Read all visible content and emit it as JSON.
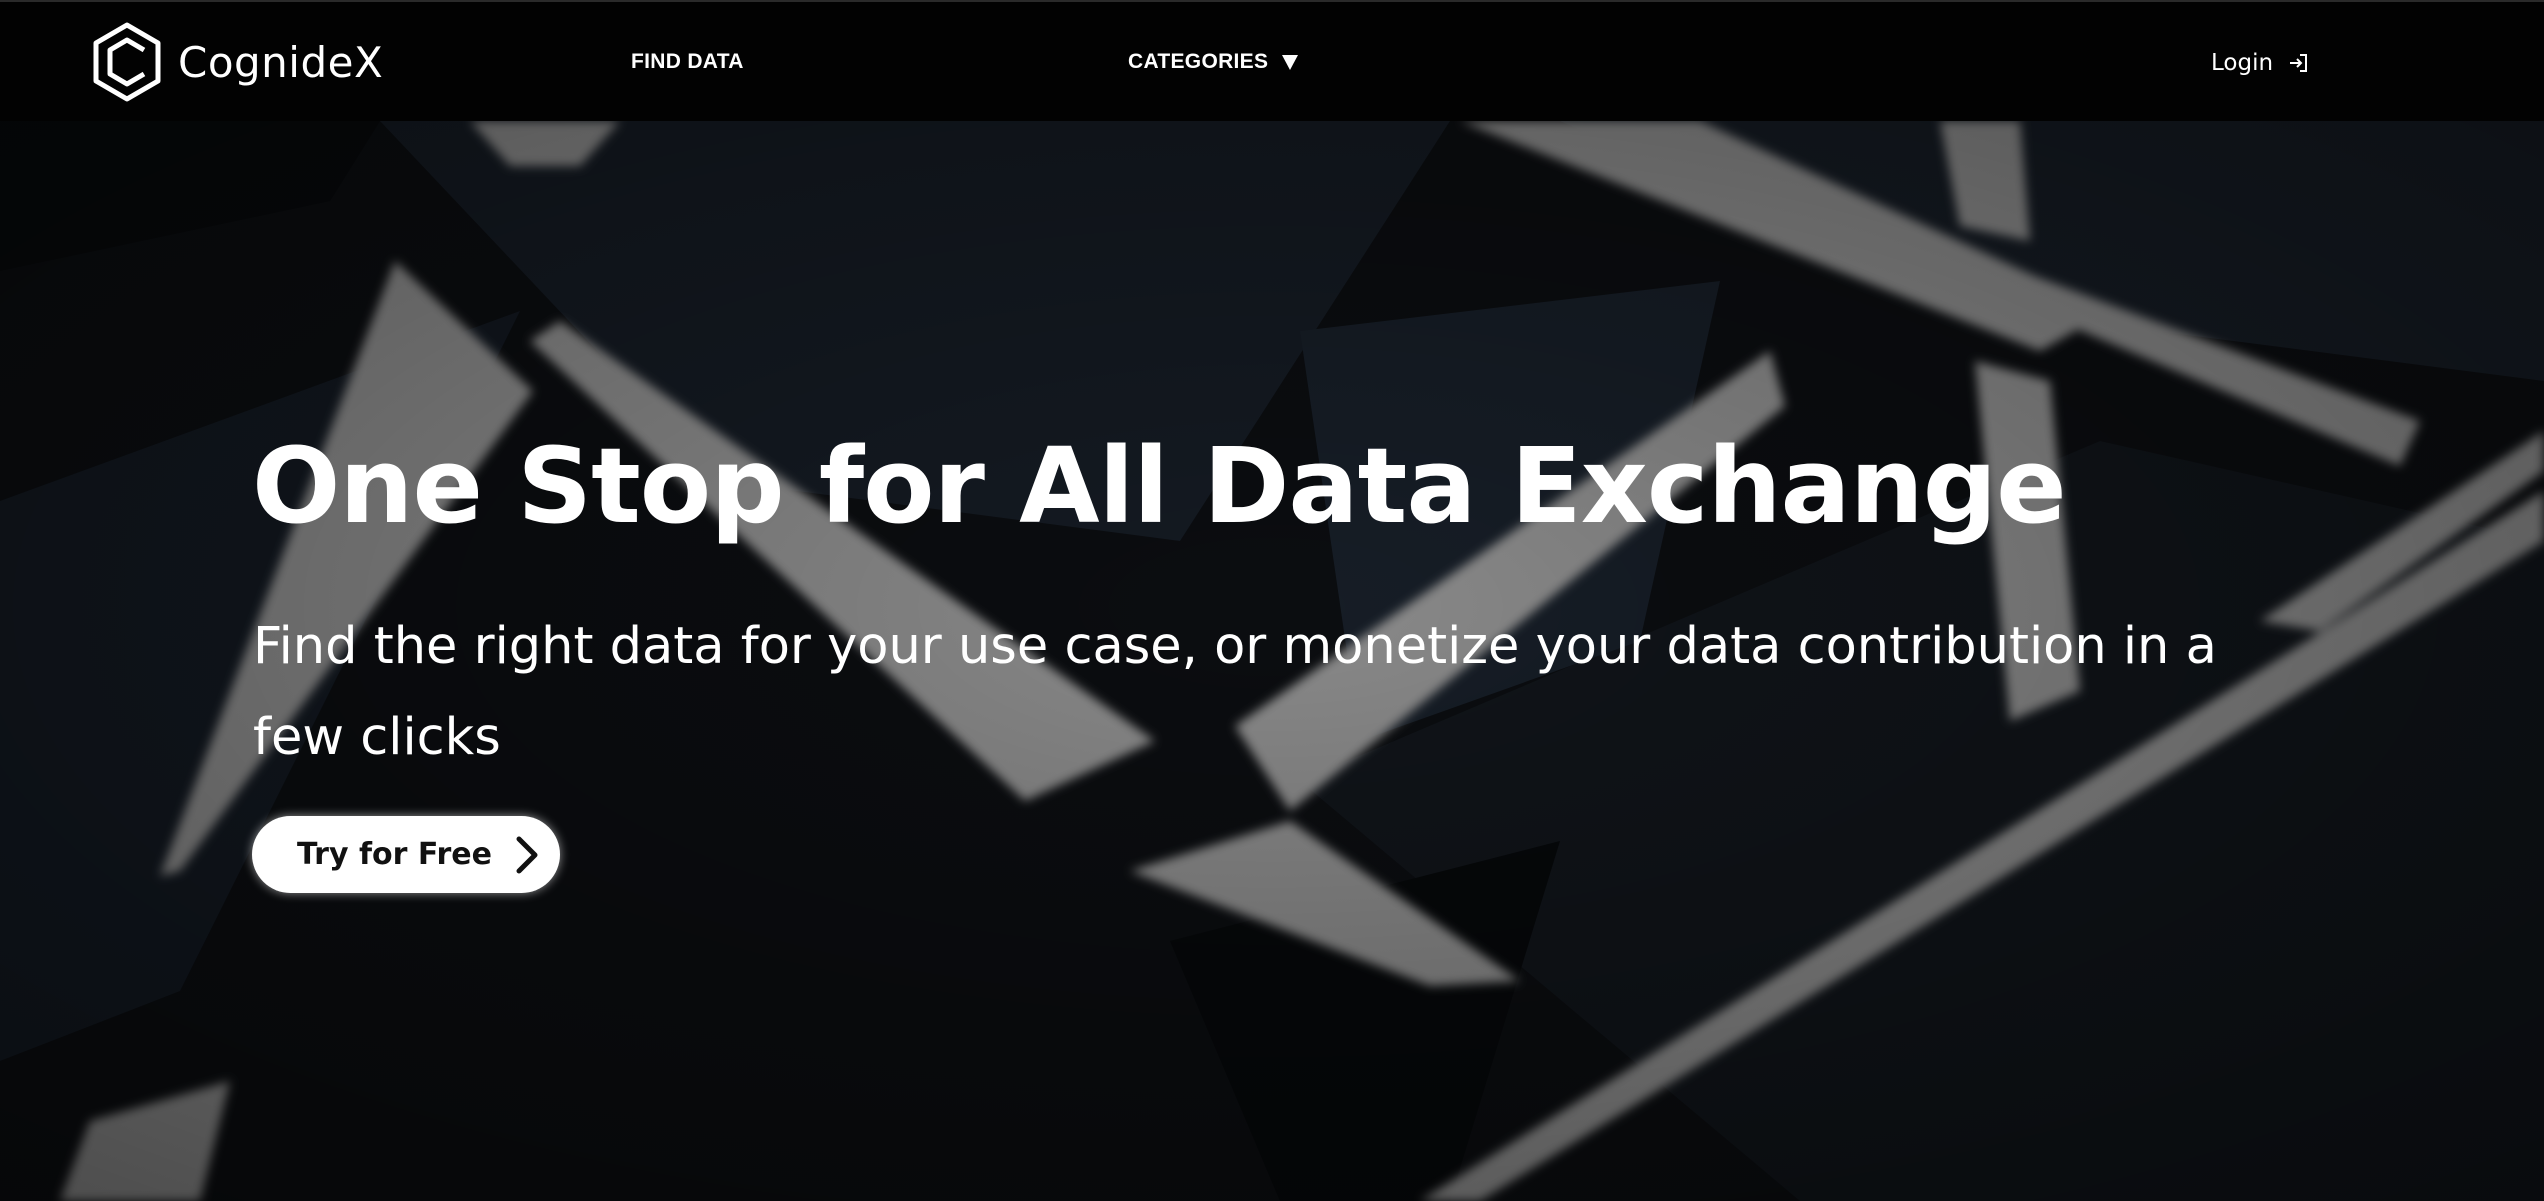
{
  "brand": {
    "name": "CognideX",
    "logo_icon": "hexagon-logo-icon"
  },
  "nav": {
    "find_data": "FIND DATA",
    "categories": "CATEGORIES",
    "categories_icon": "caret-down-icon",
    "login": "Login",
    "login_icon": "login-arrow-icon"
  },
  "hero": {
    "title": "One Stop for All Data Exchange",
    "subtitle": "Find the right data for your use case, or monetize your data contribution in a few clicks",
    "cta_label": "Try for Free",
    "cta_icon": "chevron-right-icon"
  },
  "colors": {
    "navbar_bg": "#020202",
    "hero_bg": "#0b0d10",
    "light_beam": "#8a8a8a",
    "text": "#ffffff",
    "button_bg": "#ffffff",
    "button_text": "#111111"
  }
}
